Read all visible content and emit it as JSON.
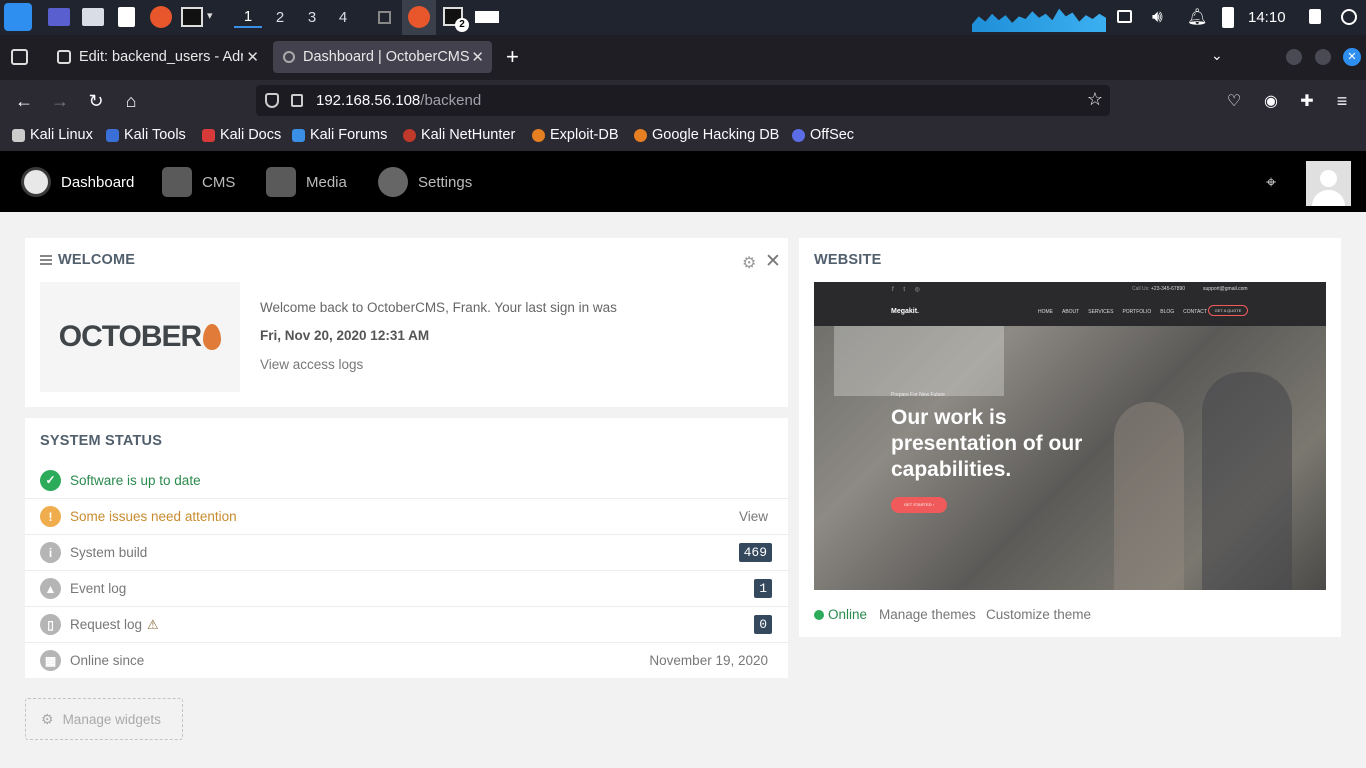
{
  "taskbar": {
    "workspaces": [
      "1",
      "2",
      "3",
      "4"
    ],
    "clock": "14:10",
    "terminal_badge": "2"
  },
  "browser": {
    "tabs": [
      {
        "label": "Edit: backend_users - Adr"
      },
      {
        "label": "Dashboard | OctoberCMS"
      }
    ],
    "url": {
      "host": "192.168.56.108",
      "path": "/backend"
    },
    "bookmarks": [
      "Kali Linux",
      "Kali Tools",
      "Kali Docs",
      "Kali Forums",
      "Kali NetHunter",
      "Exploit-DB",
      "Google Hacking DB",
      "OffSec"
    ]
  },
  "cms_nav": {
    "items": [
      "Dashboard",
      "CMS",
      "Media",
      "Settings"
    ]
  },
  "welcome": {
    "title": "WELCOME",
    "logo_text": "OCTOBER",
    "message": "Welcome back to OctoberCMS, Frank. Your last sign in was",
    "last_sign_in": "Fri, Nov 20, 2020 12:31 AM",
    "access_logs_link": "View access logs"
  },
  "system_status": {
    "title": "SYSTEM STATUS",
    "rows": [
      {
        "label": "Software is up to date",
        "value": ""
      },
      {
        "label": "Some issues need attention",
        "value": "View"
      },
      {
        "label": "System build",
        "value": "469"
      },
      {
        "label": "Event log",
        "value": "1"
      },
      {
        "label": "Request log",
        "value": "0"
      },
      {
        "label": "Online since",
        "value": "November 19, 2020"
      }
    ]
  },
  "website": {
    "title": "WEBSITE",
    "preview": {
      "contact_label": "Call Us:",
      "phone": "+23-345-67890",
      "email": "support@gmail.com",
      "brand": "Megakit.",
      "menu": [
        "HOME",
        "ABOUT",
        "SERVICES",
        "PORTFOLIO",
        "BLOG",
        "CONTACT"
      ],
      "quote_button": "GET A QUOTE",
      "kicker": "Prepare For New Future",
      "headline_lines": [
        "Our work is",
        "presentation of our",
        "capabilities."
      ],
      "cta": "GET STARTED"
    },
    "status": "Online",
    "manage_themes": "Manage themes",
    "customize_theme": "Customize theme"
  },
  "manage_widgets": "Manage widgets",
  "colors": {
    "success": "#2cab5b",
    "warning": "#f0ad4e",
    "muted": "#b5b5b5",
    "badge": "#34495e"
  }
}
